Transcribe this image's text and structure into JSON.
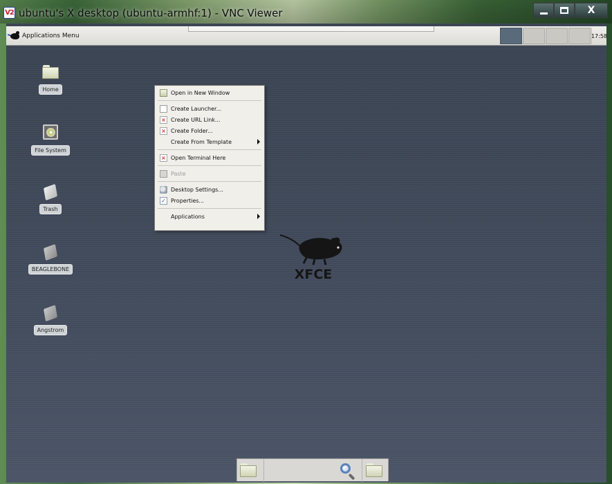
{
  "window": {
    "title": "ubuntu's X desktop (ubuntu-armhf:1) - VNC Viewer",
    "logo": "V2",
    "close_glyph": "X"
  },
  "panel": {
    "apps_menu_label": "Applications Menu",
    "clock": "17:58",
    "workspace_count": 4
  },
  "desktop_icons": [
    {
      "label": "Home",
      "icon": "home-folder-icon"
    },
    {
      "label": "File System",
      "icon": "file-system-icon"
    },
    {
      "label": "Trash",
      "icon": "trash-icon"
    },
    {
      "label": "BEAGLEBONE",
      "icon": "removable-drive-icon"
    },
    {
      "label": "Angstrom",
      "icon": "removable-drive-icon"
    }
  ],
  "context_menu": {
    "items": [
      {
        "label": "Open in New Window",
        "icon": "folder-icon"
      },
      {
        "label": "Create Launcher...",
        "icon": "document-icon"
      },
      {
        "label": "Create URL Link...",
        "icon": "missing-image-icon"
      },
      {
        "label": "Create Folder...",
        "icon": "missing-image-icon"
      },
      {
        "label": "Create From Template",
        "icon": "none",
        "submenu": true
      },
      {
        "label": "Open Terminal Here",
        "icon": "missing-image-icon"
      },
      {
        "label": "Paste",
        "icon": "paste-icon",
        "disabled": true
      },
      {
        "label": "Desktop Settings...",
        "icon": "settings-icon"
      },
      {
        "label": "Properties...",
        "icon": "properties-icon"
      },
      {
        "label": "Applications",
        "icon": "none",
        "submenu": true
      }
    ]
  },
  "logo_text": "XFCE",
  "dock": {
    "items": [
      "file-manager-icon",
      "search-icon",
      "folder-icon"
    ]
  }
}
